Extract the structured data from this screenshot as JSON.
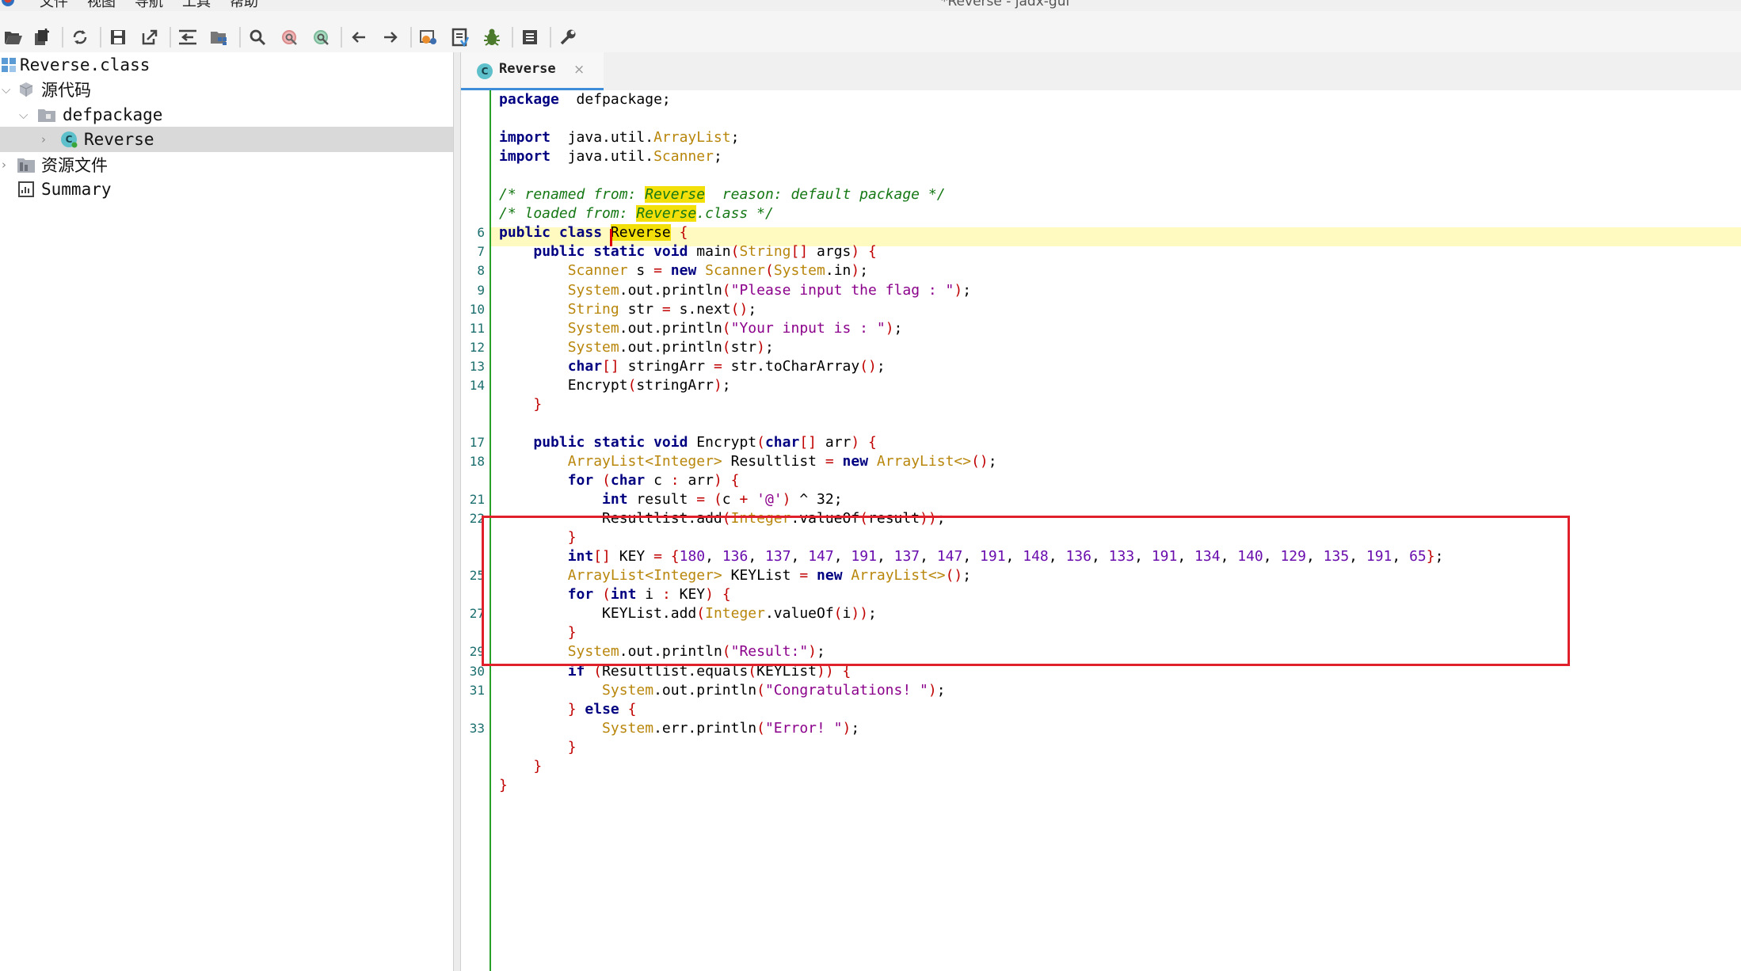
{
  "window": {
    "title": "*Reverse - jadx-gui"
  },
  "menu": [
    "文件",
    "视图",
    "导航",
    "工具",
    "帮助"
  ],
  "toolbar": {
    "icons": [
      "open-file-icon",
      "add-files-icon",
      "sync-icon",
      "save-all-icon",
      "export-icon",
      "sync-tree-icon",
      "flatten-packages-icon",
      "search-icon",
      "find-usage-icon",
      "find-class-icon",
      "back-icon",
      "forward-icon",
      "decompile-icon",
      "deobfuscation-icon",
      "debug-icon",
      "log-icon",
      "preferences-icon"
    ]
  },
  "tree": {
    "file": "Reverse.class",
    "source": "源代码",
    "package": "defpackage",
    "class": "Reverse",
    "resources": "资源文件",
    "summary": "Summary"
  },
  "tab": {
    "label": "Reverse",
    "close": "×"
  },
  "code": {
    "lines": [
      {
        "n": "",
        "parts": [
          [
            "kw",
            "package"
          ],
          [
            "",
            "  defpackage;"
          ]
        ]
      },
      {
        "n": "",
        "parts": []
      },
      {
        "n": "",
        "parts": [
          [
            "kw",
            "import"
          ],
          [
            "",
            "  java.util."
          ],
          [
            "ty",
            "ArrayList"
          ],
          [
            "",
            ";"
          ]
        ]
      },
      {
        "n": "",
        "parts": [
          [
            "kw",
            "import"
          ],
          [
            "",
            "  java.util."
          ],
          [
            "ty",
            "Scanner"
          ],
          [
            "",
            ";"
          ]
        ]
      },
      {
        "n": "",
        "parts": []
      },
      {
        "n": "",
        "parts": [
          [
            "cm",
            "/* renamed from: "
          ],
          [
            "cm hl",
            "Reverse"
          ],
          [
            "cm",
            "  reason: default package */"
          ]
        ]
      },
      {
        "n": "",
        "parts": [
          [
            "cm",
            "/* loaded from: "
          ],
          [
            "cm hl",
            "Reverse"
          ],
          [
            "cm",
            ".class */"
          ]
        ]
      },
      {
        "n": "6",
        "parts": [
          [
            "kw",
            "public class "
          ],
          [
            "hl",
            "Reverse"
          ],
          [
            "pu",
            " {"
          ]
        ]
      },
      {
        "n": "7",
        "parts": [
          [
            "",
            "    "
          ],
          [
            "kw",
            "public static void "
          ],
          [
            "",
            "main"
          ],
          [
            "pu",
            "("
          ],
          [
            "ty",
            "String"
          ],
          [
            "pu",
            "[]"
          ],
          [
            "",
            " args"
          ],
          [
            "pu",
            ") {"
          ]
        ]
      },
      {
        "n": "8",
        "parts": [
          [
            "",
            "        "
          ],
          [
            "ty",
            "Scanner"
          ],
          [
            "",
            " s "
          ],
          [
            "pu",
            "= "
          ],
          [
            "kw",
            "new "
          ],
          [
            "ty",
            "Scanner"
          ],
          [
            "pu",
            "("
          ],
          [
            "ty",
            "System"
          ],
          [
            "",
            ".in"
          ],
          [
            "pu",
            ")"
          ],
          [
            "",
            ";"
          ]
        ]
      },
      {
        "n": "9",
        "parts": [
          [
            "",
            "        "
          ],
          [
            "ty",
            "System"
          ],
          [
            "",
            ".out.println"
          ],
          [
            "pu",
            "("
          ],
          [
            "str",
            "\"Please input the flag : \""
          ],
          [
            "pu",
            ")"
          ],
          [
            "",
            ";"
          ]
        ]
      },
      {
        "n": "10",
        "parts": [
          [
            "",
            "        "
          ],
          [
            "ty",
            "String"
          ],
          [
            "",
            " str "
          ],
          [
            "pu",
            "= "
          ],
          [
            "",
            "s.next"
          ],
          [
            "pu",
            "()"
          ],
          [
            "",
            ";"
          ]
        ]
      },
      {
        "n": "11",
        "parts": [
          [
            "",
            "        "
          ],
          [
            "ty",
            "System"
          ],
          [
            "",
            ".out.println"
          ],
          [
            "pu",
            "("
          ],
          [
            "str",
            "\"Your input is : \""
          ],
          [
            "pu",
            ")"
          ],
          [
            "",
            ";"
          ]
        ]
      },
      {
        "n": "12",
        "parts": [
          [
            "",
            "        "
          ],
          [
            "ty",
            "System"
          ],
          [
            "",
            ".out.println"
          ],
          [
            "pu",
            "("
          ],
          [
            "",
            "str"
          ],
          [
            "pu",
            ")"
          ],
          [
            "",
            ";"
          ]
        ]
      },
      {
        "n": "13",
        "parts": [
          [
            "",
            "        "
          ],
          [
            "kw",
            "char"
          ],
          [
            "pu",
            "[]"
          ],
          [
            "",
            " stringArr "
          ],
          [
            "pu",
            "= "
          ],
          [
            "",
            "str.toCharArray"
          ],
          [
            "pu",
            "()"
          ],
          [
            "",
            ";"
          ]
        ]
      },
      {
        "n": "14",
        "parts": [
          [
            "",
            "        "
          ],
          [
            "",
            "Encrypt"
          ],
          [
            "pu",
            "("
          ],
          [
            "",
            "stringArr"
          ],
          [
            "pu",
            ")"
          ],
          [
            "",
            ";"
          ]
        ]
      },
      {
        "n": "",
        "parts": [
          [
            "",
            "    "
          ],
          [
            "pu",
            "}"
          ]
        ]
      },
      {
        "n": "",
        "parts": []
      },
      {
        "n": "17",
        "parts": [
          [
            "",
            "    "
          ],
          [
            "kw",
            "public static void "
          ],
          [
            "",
            "Encrypt"
          ],
          [
            "pu",
            "("
          ],
          [
            "kw",
            "char"
          ],
          [
            "pu",
            "[]"
          ],
          [
            "",
            " arr"
          ],
          [
            "pu",
            ") {"
          ]
        ]
      },
      {
        "n": "18",
        "parts": [
          [
            "",
            "        "
          ],
          [
            "ty",
            "ArrayList<Integer>"
          ],
          [
            "",
            " Resultlist "
          ],
          [
            "pu",
            "= "
          ],
          [
            "kw",
            "new "
          ],
          [
            "ty",
            "ArrayList<>"
          ],
          [
            "pu",
            "()"
          ],
          [
            "",
            ";"
          ]
        ]
      },
      {
        "n": "",
        "parts": [
          [
            "",
            "        "
          ],
          [
            "kw",
            "for "
          ],
          [
            "pu",
            "("
          ],
          [
            "kw",
            "char"
          ],
          [
            "",
            " c "
          ],
          [
            "pu",
            ": "
          ],
          [
            "",
            "arr"
          ],
          [
            "pu",
            ") {"
          ]
        ]
      },
      {
        "n": "21",
        "parts": [
          [
            "",
            "            "
          ],
          [
            "kw",
            "int"
          ],
          [
            "",
            " result "
          ],
          [
            "pu",
            "= ("
          ],
          [
            "",
            "c "
          ],
          [
            "pu",
            "+ "
          ],
          [
            "str",
            "'@'"
          ],
          [
            "pu",
            ") "
          ],
          [
            "",
            "^ 32;"
          ]
        ]
      },
      {
        "n": "22",
        "parts": [
          [
            "",
            "            "
          ],
          [
            "",
            "Resultlist.add"
          ],
          [
            "pu",
            "("
          ],
          [
            "ty",
            "Integer"
          ],
          [
            "",
            ".valueOf"
          ],
          [
            "pu",
            "("
          ],
          [
            "",
            "result"
          ],
          [
            "pu",
            "))"
          ],
          [
            "",
            ";"
          ]
        ]
      },
      {
        "n": "",
        "parts": [
          [
            "",
            "        "
          ],
          [
            "pu",
            "}"
          ]
        ]
      },
      {
        "n": "",
        "parts": [
          [
            "",
            "        "
          ],
          [
            "kw",
            "int"
          ],
          [
            "pu",
            "[]"
          ],
          [
            "",
            " KEY "
          ],
          [
            "pu",
            "= {"
          ],
          [
            "num",
            "180"
          ],
          [
            "",
            ", "
          ],
          [
            "num",
            "136"
          ],
          [
            "",
            ", "
          ],
          [
            "num",
            "137"
          ],
          [
            "",
            ", "
          ],
          [
            "num",
            "147"
          ],
          [
            "",
            ", "
          ],
          [
            "num",
            "191"
          ],
          [
            "",
            ", "
          ],
          [
            "num",
            "137"
          ],
          [
            "",
            ", "
          ],
          [
            "num",
            "147"
          ],
          [
            "",
            ", "
          ],
          [
            "num",
            "191"
          ],
          [
            "",
            ", "
          ],
          [
            "num",
            "148"
          ],
          [
            "",
            ", "
          ],
          [
            "num",
            "136"
          ],
          [
            "",
            ", "
          ],
          [
            "num",
            "133"
          ],
          [
            "",
            ", "
          ],
          [
            "num",
            "191"
          ],
          [
            "",
            ", "
          ],
          [
            "num",
            "134"
          ],
          [
            "",
            ", "
          ],
          [
            "num",
            "140"
          ],
          [
            "",
            ", "
          ],
          [
            "num",
            "129"
          ],
          [
            "",
            ", "
          ],
          [
            "num",
            "135"
          ],
          [
            "",
            ", "
          ],
          [
            "num",
            "191"
          ],
          [
            "",
            ", "
          ],
          [
            "num",
            "65"
          ],
          [
            "pu",
            "}"
          ],
          [
            "",
            ";"
          ]
        ]
      },
      {
        "n": "25",
        "parts": [
          [
            "",
            "        "
          ],
          [
            "ty",
            "ArrayList<Integer>"
          ],
          [
            "",
            " KEYList "
          ],
          [
            "pu",
            "= "
          ],
          [
            "kw",
            "new "
          ],
          [
            "ty",
            "ArrayList<>"
          ],
          [
            "pu",
            "()"
          ],
          [
            "",
            ";"
          ]
        ]
      },
      {
        "n": "",
        "parts": [
          [
            "",
            "        "
          ],
          [
            "kw",
            "for "
          ],
          [
            "pu",
            "("
          ],
          [
            "kw",
            "int"
          ],
          [
            "",
            " i "
          ],
          [
            "pu",
            ": "
          ],
          [
            "",
            "KEY"
          ],
          [
            "pu",
            ") {"
          ]
        ]
      },
      {
        "n": "27",
        "parts": [
          [
            "",
            "            "
          ],
          [
            "",
            "KEYList.add"
          ],
          [
            "pu",
            "("
          ],
          [
            "ty",
            "Integer"
          ],
          [
            "",
            ".valueOf"
          ],
          [
            "pu",
            "("
          ],
          [
            "",
            "i"
          ],
          [
            "pu",
            "))"
          ],
          [
            "",
            ";"
          ]
        ]
      },
      {
        "n": "",
        "parts": [
          [
            "",
            "        "
          ],
          [
            "pu",
            "}"
          ]
        ]
      },
      {
        "n": "29",
        "parts": [
          [
            "",
            "        "
          ],
          [
            "ty",
            "System"
          ],
          [
            "",
            ".out.println"
          ],
          [
            "pu",
            "("
          ],
          [
            "str",
            "\"Result:\""
          ],
          [
            "pu",
            ")"
          ],
          [
            "",
            ";"
          ]
        ]
      },
      {
        "n": "30",
        "parts": [
          [
            "",
            "        "
          ],
          [
            "kw",
            "if "
          ],
          [
            "pu",
            "("
          ],
          [
            "",
            "Resultlist.equals"
          ],
          [
            "pu",
            "("
          ],
          [
            "",
            "KEYList"
          ],
          [
            "pu",
            ")) {"
          ]
        ]
      },
      {
        "n": "31",
        "parts": [
          [
            "",
            "            "
          ],
          [
            "ty",
            "System"
          ],
          [
            "",
            ".out.println"
          ],
          [
            "pu",
            "("
          ],
          [
            "str",
            "\"Congratulations! \""
          ],
          [
            "pu",
            ")"
          ],
          [
            "",
            ";"
          ]
        ]
      },
      {
        "n": "",
        "parts": [
          [
            "",
            "        "
          ],
          [
            "pu",
            "} "
          ],
          [
            "kw",
            "else "
          ],
          [
            "pu",
            "{"
          ]
        ]
      },
      {
        "n": "33",
        "parts": [
          [
            "",
            "            "
          ],
          [
            "ty",
            "System"
          ],
          [
            "",
            ".err.println"
          ],
          [
            "pu",
            "("
          ],
          [
            "str",
            "\"Error! \""
          ],
          [
            "pu",
            ")"
          ],
          [
            "",
            ";"
          ]
        ]
      },
      {
        "n": "",
        "parts": [
          [
            "",
            "        "
          ],
          [
            "pu",
            "}"
          ]
        ]
      },
      {
        "n": "",
        "parts": [
          [
            "",
            "    "
          ],
          [
            "pu",
            "}"
          ]
        ]
      },
      {
        "n": "",
        "parts": [
          [
            "pu",
            "}"
          ]
        ]
      }
    ]
  },
  "colors": {
    "accent": "#3d8dd8",
    "highlight": "#f3df0a",
    "annotation_box": "#e0202a",
    "gutter": "#28a028"
  }
}
